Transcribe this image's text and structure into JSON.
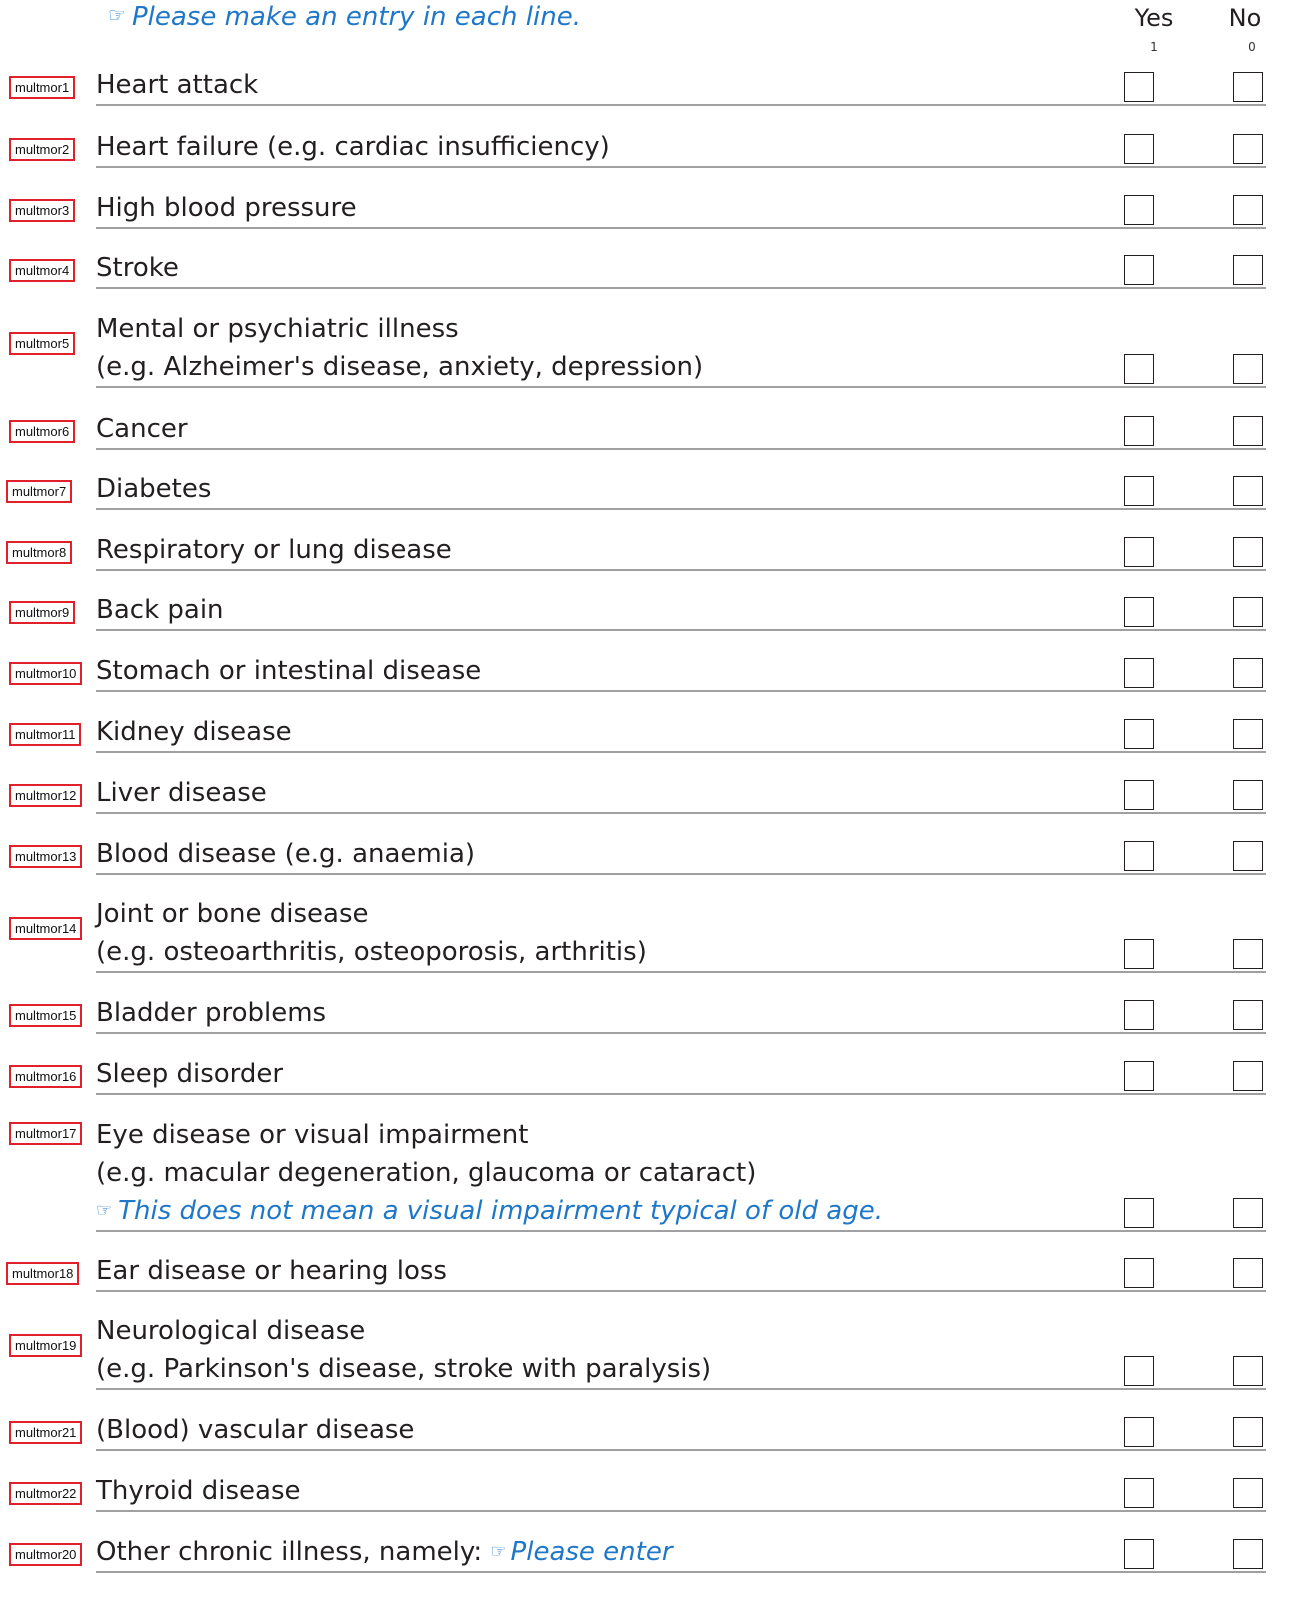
{
  "instruction": {
    "icon": "pointing-hand-icon",
    "text": "Please make an entry in each line."
  },
  "columns": {
    "yes": {
      "label": "Yes",
      "code": "1"
    },
    "no": {
      "label": "No",
      "code": "0"
    }
  },
  "rows": [
    {
      "code": "multmor1",
      "lines": [
        "Heart attack"
      ]
    },
    {
      "code": "multmor2",
      "lines": [
        "Heart failure (e.g. cardiac insufficiency)"
      ]
    },
    {
      "code": "multmor3",
      "lines": [
        "High blood pressure"
      ]
    },
    {
      "code": "multmor4",
      "lines": [
        "Stroke"
      ]
    },
    {
      "code": "multmor5",
      "lines": [
        "Mental or psychiatric illness",
        "(e.g. Alzheimer's disease, anxiety, depression)"
      ]
    },
    {
      "code": "multmor6",
      "lines": [
        "Cancer"
      ]
    },
    {
      "code": "multmor7",
      "lines": [
        "Diabetes"
      ]
    },
    {
      "code": "multmor8",
      "lines": [
        "Respiratory or lung disease"
      ]
    },
    {
      "code": "multmor9",
      "lines": [
        "Back pain"
      ]
    },
    {
      "code": "multmor10",
      "lines": [
        "Stomach or intestinal disease"
      ]
    },
    {
      "code": "multmor11",
      "lines": [
        "Kidney disease"
      ]
    },
    {
      "code": "multmor12",
      "lines": [
        "Liver disease"
      ]
    },
    {
      "code": "multmor13",
      "lines": [
        "Blood disease (e.g. anaemia)"
      ]
    },
    {
      "code": "multmor14",
      "lines": [
        "Joint or bone disease",
        "(e.g. osteoarthritis, osteoporosis, arthritis)"
      ]
    },
    {
      "code": "multmor15",
      "lines": [
        "Bladder problems"
      ]
    },
    {
      "code": "multmor16",
      "lines": [
        "Sleep disorder"
      ]
    },
    {
      "code": "multmor17",
      "lines": [
        "Eye disease or visual impairment",
        "(e.g. macular degeneration, glaucoma or cataract)"
      ],
      "note": "This does not mean a visual impairment typical of old age."
    },
    {
      "code": "multmor18",
      "lines": [
        "Ear disease or hearing loss"
      ]
    },
    {
      "code": "multmor19",
      "lines": [
        "Neurological disease",
        "(e.g. Parkinson's disease, stroke with paralysis)"
      ]
    },
    {
      "code": "multmor21",
      "lines": [
        "(Blood) vascular disease"
      ]
    },
    {
      "code": "multmor22",
      "lines": [
        "Thyroid disease"
      ]
    },
    {
      "code": "multmor20",
      "lines": [
        "Other chronic illness, namely:"
      ],
      "inline_note": "Please enter"
    }
  ],
  "colors": {
    "note_blue": "#1f77c8",
    "tag_red": "#e0202a",
    "rule_grey": "#a0a0a0"
  }
}
